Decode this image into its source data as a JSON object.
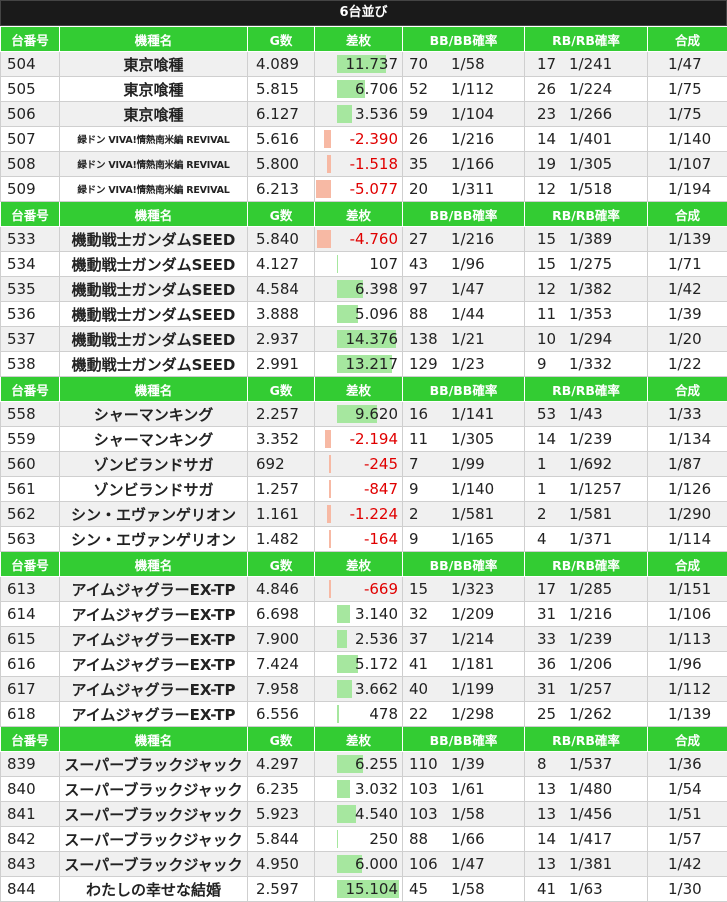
{
  "title": "6台並び",
  "headers": [
    "台番号",
    "機種名",
    "G数",
    "差枚",
    "BB/BB確率",
    "RB/RB確率",
    "合成"
  ],
  "bar_scale_max": 15000,
  "colors": {
    "header_bg": "#33cc33",
    "positive_bar": "#a6e79f",
    "negative_bar": "#f7b9a4",
    "negative_text": "#e00000"
  },
  "groups": [
    {
      "rows": [
        {
          "no": "504",
          "name": "東京喰種",
          "g": "4.089",
          "diff": "11.737",
          "diff_value": 11737,
          "bb": "70",
          "bb_rate": "1/58",
          "rb": "17",
          "rb_rate": "1/241",
          "total": "1/47"
        },
        {
          "no": "505",
          "name": "東京喰種",
          "g": "5.815",
          "diff": "6.706",
          "diff_value": 6706,
          "bb": "52",
          "bb_rate": "1/112",
          "rb": "26",
          "rb_rate": "1/224",
          "total": "1/75"
        },
        {
          "no": "506",
          "name": "東京喰種",
          "g": "6.127",
          "diff": "3.536",
          "diff_value": 3536,
          "bb": "59",
          "bb_rate": "1/104",
          "rb": "23",
          "rb_rate": "1/266",
          "total": "1/75"
        },
        {
          "no": "507",
          "name": "緑ドン VIVA!情熱南米編 REVIVAL",
          "small": true,
          "g": "5.616",
          "diff": "-2.390",
          "diff_value": -2390,
          "bb": "26",
          "bb_rate": "1/216",
          "rb": "14",
          "rb_rate": "1/401",
          "total": "1/140"
        },
        {
          "no": "508",
          "name": "緑ドン VIVA!情熱南米編 REVIVAL",
          "small": true,
          "g": "5.800",
          "diff": "-1.518",
          "diff_value": -1518,
          "bb": "35",
          "bb_rate": "1/166",
          "rb": "19",
          "rb_rate": "1/305",
          "total": "1/107"
        },
        {
          "no": "509",
          "name": "緑ドン VIVA!情熱南米編 REVIVAL",
          "small": true,
          "g": "6.213",
          "diff": "-5.077",
          "diff_value": -5077,
          "bb": "20",
          "bb_rate": "1/311",
          "rb": "12",
          "rb_rate": "1/518",
          "total": "1/194"
        }
      ]
    },
    {
      "rows": [
        {
          "no": "533",
          "name": "機動戦士ガンダムSEED",
          "g": "5.840",
          "diff": "-4.760",
          "diff_value": -4760,
          "bb": "27",
          "bb_rate": "1/216",
          "rb": "15",
          "rb_rate": "1/389",
          "total": "1/139"
        },
        {
          "no": "534",
          "name": "機動戦士ガンダムSEED",
          "g": "4.127",
          "diff": "107",
          "diff_value": 107,
          "bb": "43",
          "bb_rate": "1/96",
          "rb": "15",
          "rb_rate": "1/275",
          "total": "1/71"
        },
        {
          "no": "535",
          "name": "機動戦士ガンダムSEED",
          "g": "4.584",
          "diff": "6.398",
          "diff_value": 6398,
          "bb": "97",
          "bb_rate": "1/47",
          "rb": "12",
          "rb_rate": "1/382",
          "total": "1/42"
        },
        {
          "no": "536",
          "name": "機動戦士ガンダムSEED",
          "g": "3.888",
          "diff": "5.096",
          "diff_value": 5096,
          "bb": "88",
          "bb_rate": "1/44",
          "rb": "11",
          "rb_rate": "1/353",
          "total": "1/39"
        },
        {
          "no": "537",
          "name": "機動戦士ガンダムSEED",
          "g": "2.937",
          "diff": "14.376",
          "diff_value": 14376,
          "bb": "138",
          "bb_rate": "1/21",
          "rb": "10",
          "rb_rate": "1/294",
          "total": "1/20"
        },
        {
          "no": "538",
          "name": "機動戦士ガンダムSEED",
          "g": "2.991",
          "diff": "13.217",
          "diff_value": 13217,
          "bb": "129",
          "bb_rate": "1/23",
          "rb": "9",
          "rb_rate": "1/332",
          "total": "1/22"
        }
      ]
    },
    {
      "rows": [
        {
          "no": "558",
          "name": "シャーマンキング",
          "g": "2.257",
          "diff": "9.620",
          "diff_value": 9620,
          "bb": "16",
          "bb_rate": "1/141",
          "rb": "53",
          "rb_rate": "1/43",
          "total": "1/33"
        },
        {
          "no": "559",
          "name": "シャーマンキング",
          "g": "3.352",
          "diff": "-2.194",
          "diff_value": -2194,
          "bb": "11",
          "bb_rate": "1/305",
          "rb": "14",
          "rb_rate": "1/239",
          "total": "1/134"
        },
        {
          "no": "560",
          "name": "ゾンビランドサガ",
          "g": "692",
          "diff": "-245",
          "diff_value": -245,
          "bb": "7",
          "bb_rate": "1/99",
          "rb": "1",
          "rb_rate": "1/692",
          "total": "1/87"
        },
        {
          "no": "561",
          "name": "ゾンビランドサガ",
          "g": "1.257",
          "diff": "-847",
          "diff_value": -847,
          "bb": "9",
          "bb_rate": "1/140",
          "rb": "1",
          "rb_rate": "1/1257",
          "total": "1/126"
        },
        {
          "no": "562",
          "name": "シン・エヴァンゲリオン",
          "g": "1.161",
          "diff": "-1.224",
          "diff_value": -1224,
          "bb": "2",
          "bb_rate": "1/581",
          "rb": "2",
          "rb_rate": "1/581",
          "total": "1/290"
        },
        {
          "no": "563",
          "name": "シン・エヴァンゲリオン",
          "g": "1.482",
          "diff": "-164",
          "diff_value": -164,
          "bb": "9",
          "bb_rate": "1/165",
          "rb": "4",
          "rb_rate": "1/371",
          "total": "1/114"
        }
      ]
    },
    {
      "rows": [
        {
          "no": "613",
          "name": "アイムジャグラーEX-TP",
          "g": "4.846",
          "diff": "-669",
          "diff_value": -669,
          "bb": "15",
          "bb_rate": "1/323",
          "rb": "17",
          "rb_rate": "1/285",
          "total": "1/151"
        },
        {
          "no": "614",
          "name": "アイムジャグラーEX-TP",
          "g": "6.698",
          "diff": "3.140",
          "diff_value": 3140,
          "bb": "32",
          "bb_rate": "1/209",
          "rb": "31",
          "rb_rate": "1/216",
          "total": "1/106"
        },
        {
          "no": "615",
          "name": "アイムジャグラーEX-TP",
          "g": "7.900",
          "diff": "2.536",
          "diff_value": 2536,
          "bb": "37",
          "bb_rate": "1/214",
          "rb": "33",
          "rb_rate": "1/239",
          "total": "1/113"
        },
        {
          "no": "616",
          "name": "アイムジャグラーEX-TP",
          "g": "7.424",
          "diff": "5.172",
          "diff_value": 5172,
          "bb": "41",
          "bb_rate": "1/181",
          "rb": "36",
          "rb_rate": "1/206",
          "total": "1/96"
        },
        {
          "no": "617",
          "name": "アイムジャグラーEX-TP",
          "g": "7.958",
          "diff": "3.662",
          "diff_value": 3662,
          "bb": "40",
          "bb_rate": "1/199",
          "rb": "31",
          "rb_rate": "1/257",
          "total": "1/112"
        },
        {
          "no": "618",
          "name": "アイムジャグラーEX-TP",
          "g": "6.556",
          "diff": "478",
          "diff_value": 478,
          "bb": "22",
          "bb_rate": "1/298",
          "rb": "25",
          "rb_rate": "1/262",
          "total": "1/139"
        }
      ]
    },
    {
      "rows": [
        {
          "no": "839",
          "name": "スーパーブラックジャック",
          "g": "4.297",
          "diff": "6.255",
          "diff_value": 6255,
          "bb": "110",
          "bb_rate": "1/39",
          "rb": "8",
          "rb_rate": "1/537",
          "total": "1/36"
        },
        {
          "no": "840",
          "name": "スーパーブラックジャック",
          "g": "6.235",
          "diff": "3.032",
          "diff_value": 3032,
          "bb": "103",
          "bb_rate": "1/61",
          "rb": "13",
          "rb_rate": "1/480",
          "total": "1/54"
        },
        {
          "no": "841",
          "name": "スーパーブラックジャック",
          "g": "5.923",
          "diff": "4.540",
          "diff_value": 4540,
          "bb": "103",
          "bb_rate": "1/58",
          "rb": "13",
          "rb_rate": "1/456",
          "total": "1/51"
        },
        {
          "no": "842",
          "name": "スーパーブラックジャック",
          "g": "5.844",
          "diff": "250",
          "diff_value": 250,
          "bb": "88",
          "bb_rate": "1/66",
          "rb": "14",
          "rb_rate": "1/417",
          "total": "1/57"
        },
        {
          "no": "843",
          "name": "スーパーブラックジャック",
          "g": "4.950",
          "diff": "6.000",
          "diff_value": 6000,
          "bb": "106",
          "bb_rate": "1/47",
          "rb": "13",
          "rb_rate": "1/381",
          "total": "1/42"
        },
        {
          "no": "844",
          "name": "わたしの幸せな結婚",
          "g": "2.597",
          "diff": "15.104",
          "diff_value": 15104,
          "bb": "45",
          "bb_rate": "1/58",
          "rb": "41",
          "rb_rate": "1/63",
          "total": "1/30"
        }
      ]
    }
  ]
}
